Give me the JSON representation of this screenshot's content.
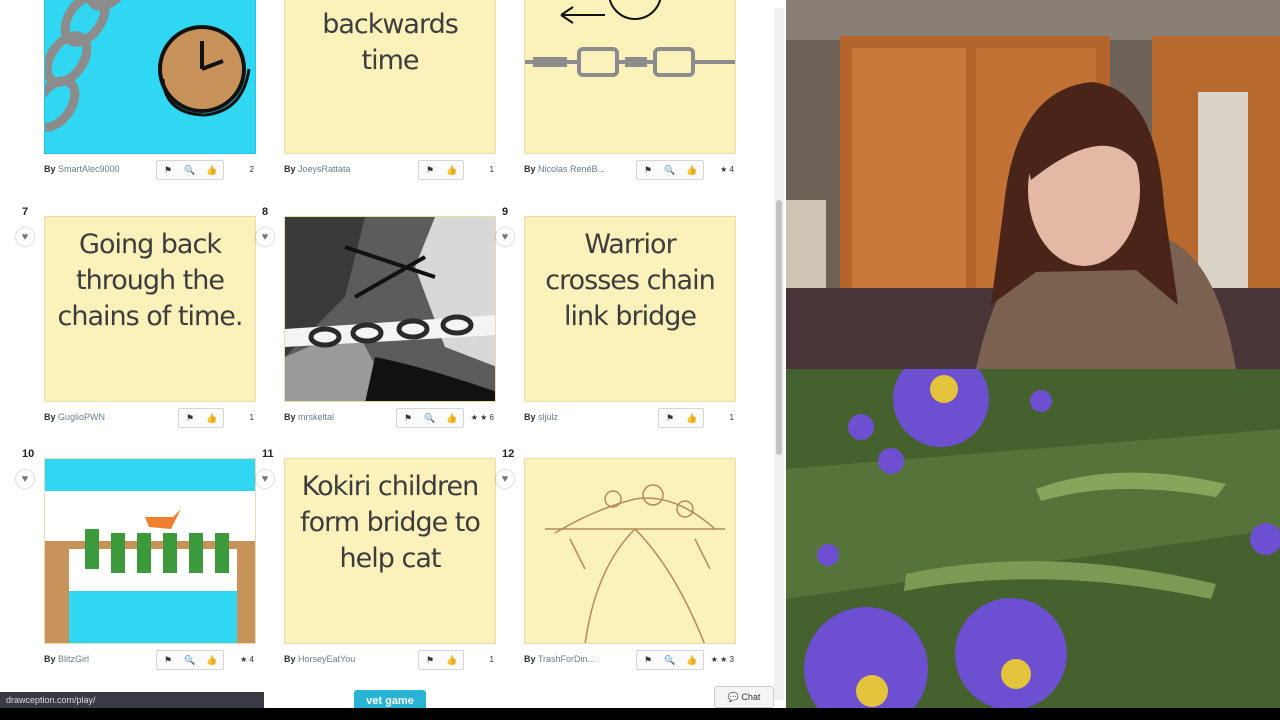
{
  "browser": {
    "status_url": "drawception.com/play/",
    "vet_game_label": "vet game",
    "chat_label": "Chat",
    "chat_icon": "speech-bubble-icon"
  },
  "panels": [
    {
      "number": "",
      "caption": "",
      "author": "SmartAlec9000",
      "by": "By",
      "count": "2",
      "tools": [
        "flag-icon",
        "zoom-icon",
        "like-icon"
      ],
      "kind": "drawing-clock-chain"
    },
    {
      "number": "",
      "caption": "The chain of backwards time",
      "author": "JoeysRattata",
      "by": "By",
      "count": "1",
      "tools": [
        "flag-icon",
        "like-icon"
      ],
      "kind": "text"
    },
    {
      "number": "",
      "caption": "",
      "author": "Nicolas RenéB...",
      "by": "By",
      "count": "★ 4",
      "tools": [
        "flag-icon",
        "zoom-icon",
        "like-icon"
      ],
      "kind": "drawing-chain-clock"
    },
    {
      "number": "7",
      "caption": "Going back through the chains of time.",
      "author": "GuglioPWN",
      "by": "By",
      "count": "1",
      "tools": [
        "flag-icon",
        "like-icon"
      ],
      "kind": "text"
    },
    {
      "number": "8",
      "caption": "",
      "author": "mrskeltal",
      "by": "By",
      "count": "★ ★ 6",
      "tools": [
        "flag-icon",
        "zoom-icon",
        "like-icon"
      ],
      "kind": "drawing-warrior"
    },
    {
      "number": "9",
      "caption": "Warrior crosses chain link bridge",
      "author": "sljulz",
      "by": "By",
      "count": "1",
      "tools": [
        "flag-icon",
        "like-icon"
      ],
      "kind": "text"
    },
    {
      "number": "10",
      "caption": "",
      "author": "BlitzGirl",
      "by": "By",
      "count": "★ 4",
      "tools": [
        "flag-icon",
        "zoom-icon",
        "like-icon"
      ],
      "kind": "drawing-kokiri"
    },
    {
      "number": "11",
      "caption": "Kokiri children form bridge to help cat",
      "author": "HorseyEatYou",
      "by": "By",
      "count": "1",
      "tools": [
        "flag-icon",
        "like-icon"
      ],
      "kind": "text"
    },
    {
      "number": "12",
      "caption": "",
      "author": "TrashForDin...",
      "by": "By",
      "count": "★ ★ 3",
      "tools": [
        "flag-icon",
        "zoom-icon",
        "like-icon"
      ],
      "kind": "drawing-sketch-bridge"
    }
  ]
}
